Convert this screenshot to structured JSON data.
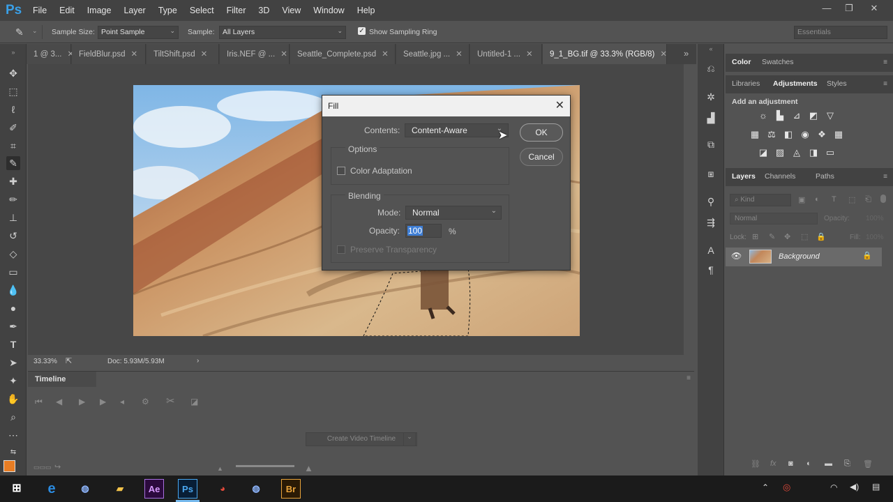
{
  "app": {
    "logo": "Ps"
  },
  "menu": [
    "File",
    "Edit",
    "Image",
    "Layer",
    "Type",
    "Select",
    "Filter",
    "3D",
    "View",
    "Window",
    "Help"
  ],
  "options_bar": {
    "sample_size_label": "Sample Size:",
    "sample_size_value": "Point Sample",
    "sample_label": "Sample:",
    "sample_value": "All Layers",
    "show_sampling_ring": "Show Sampling Ring",
    "workspace": "Essentials"
  },
  "tabs": [
    {
      "label": "1 @ 3..."
    },
    {
      "label": "FieldBlur.psd"
    },
    {
      "label": "TiltShift.psd"
    },
    {
      "label": "Iris.NEF @ ..."
    },
    {
      "label": "Seattle_Complete.psd"
    },
    {
      "label": "Seattle.jpg ..."
    },
    {
      "label": "Untitled-1 ..."
    },
    {
      "label": "9_1_BG.tif @ 33.3% (RGB/8)"
    }
  ],
  "status_bar": {
    "zoom": "33.33%",
    "doc": "Doc: 5.93M/5.93M"
  },
  "timeline": {
    "title": "Timeline",
    "create_button": "Create Video Timeline"
  },
  "panels": {
    "top_tabs": [
      "Color",
      "Swatches"
    ],
    "mid_tabs": [
      "Libraries",
      "Adjustments",
      "Styles"
    ],
    "add_adjustment": "Add an adjustment",
    "layer_tabs": [
      "Layers",
      "Channels",
      "Paths"
    ],
    "kind_placeholder": "Kind",
    "blend_mode": "Normal",
    "opacity_label": "Opacity:",
    "opacity_value": "100%",
    "lock_label": "Lock:",
    "fill_label": "Fill:",
    "fill_value": "100%",
    "layer_name": "Background"
  },
  "fill_dialog": {
    "title": "Fill",
    "contents_label": "Contents:",
    "contents_value": "Content-Aware",
    "ok": "OK",
    "cancel": "Cancel",
    "options_title": "Options",
    "color_adaptation": "Color Adaptation",
    "blending_title": "Blending",
    "mode_label": "Mode:",
    "mode_value": "Normal",
    "opacity_label": "Opacity:",
    "opacity_value": "100",
    "opacity_unit": "%",
    "preserve_transparency": "Preserve Transparency"
  },
  "colors": {
    "accent": "#3aa0e8",
    "foreground_swatch": "#e87d24",
    "dialog_bg": "#535353"
  }
}
